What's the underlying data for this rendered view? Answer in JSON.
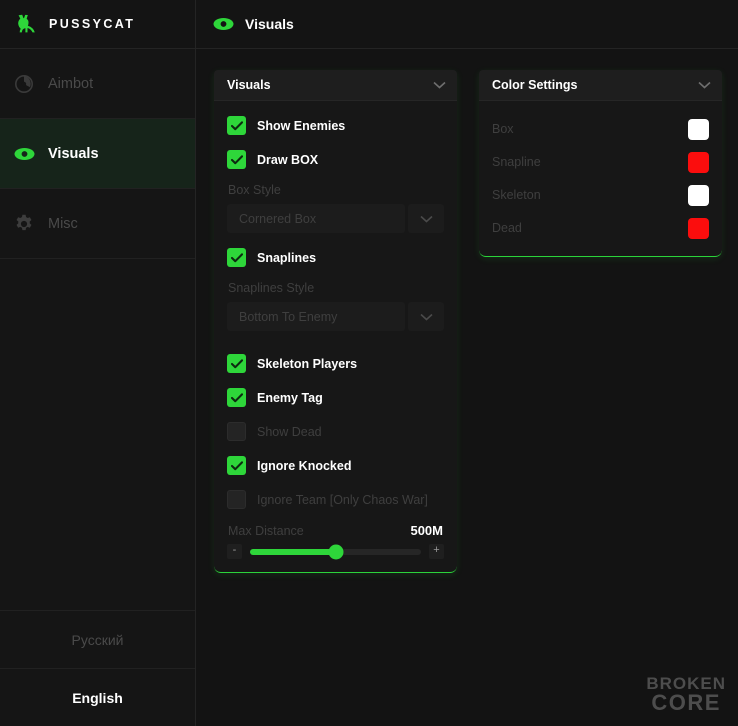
{
  "brand": {
    "name": "PUSSYCAT",
    "logo_icon": "cat-icon",
    "accent_color": "#2ed63a"
  },
  "sidebar": {
    "items": [
      {
        "label": "Aimbot",
        "icon": "crosshair-icon",
        "active": false
      },
      {
        "label": "Visuals",
        "icon": "eye-icon",
        "active": true
      },
      {
        "label": "Misc",
        "icon": "gear-icon",
        "active": false
      }
    ],
    "languages": [
      {
        "label": "Русский",
        "active": false
      },
      {
        "label": "English",
        "active": true
      }
    ]
  },
  "topbar": {
    "title": "Visuals",
    "icon": "eye-icon"
  },
  "visuals_panel": {
    "title": "Visuals",
    "chevron_icon": "chevron-down-icon",
    "show_enemies": {
      "label": "Show Enemies",
      "checked": true
    },
    "draw_box": {
      "label": "Draw BOX",
      "checked": true
    },
    "box_style": {
      "label": "Box Style",
      "value": "Cornered Box",
      "arrow_icon": "chevron-down-icon"
    },
    "snaplines": {
      "label": "Snaplines",
      "checked": true
    },
    "snaplines_style": {
      "label": "Snaplines Style",
      "value": "Bottom To Enemy",
      "arrow_icon": "chevron-down-icon"
    },
    "skeleton_players": {
      "label": "Skeleton Players",
      "checked": true
    },
    "enemy_tag": {
      "label": "Enemy Tag",
      "checked": true
    },
    "show_dead": {
      "label": "Show Dead",
      "checked": false
    },
    "ignore_knocked": {
      "label": "Ignore Knocked",
      "checked": true
    },
    "ignore_team": {
      "label": "Ignore Team [Only Chaos War]",
      "checked": false
    },
    "max_distance": {
      "label": "Max Distance",
      "value": "500M",
      "percent": 50,
      "minus_label": "-",
      "plus_label": "+"
    }
  },
  "colors_panel": {
    "title": "Color Settings",
    "chevron_icon": "chevron-down-icon",
    "rows": [
      {
        "label": "Box",
        "color": "#ffffff"
      },
      {
        "label": "Snapline",
        "color": "#fb0d0d"
      },
      {
        "label": "Skeleton",
        "color": "#ffffff"
      },
      {
        "label": "Dead",
        "color": "#fb0d0d"
      }
    ]
  },
  "watermark": {
    "line1": "BROKEN",
    "line2": "CORE"
  }
}
